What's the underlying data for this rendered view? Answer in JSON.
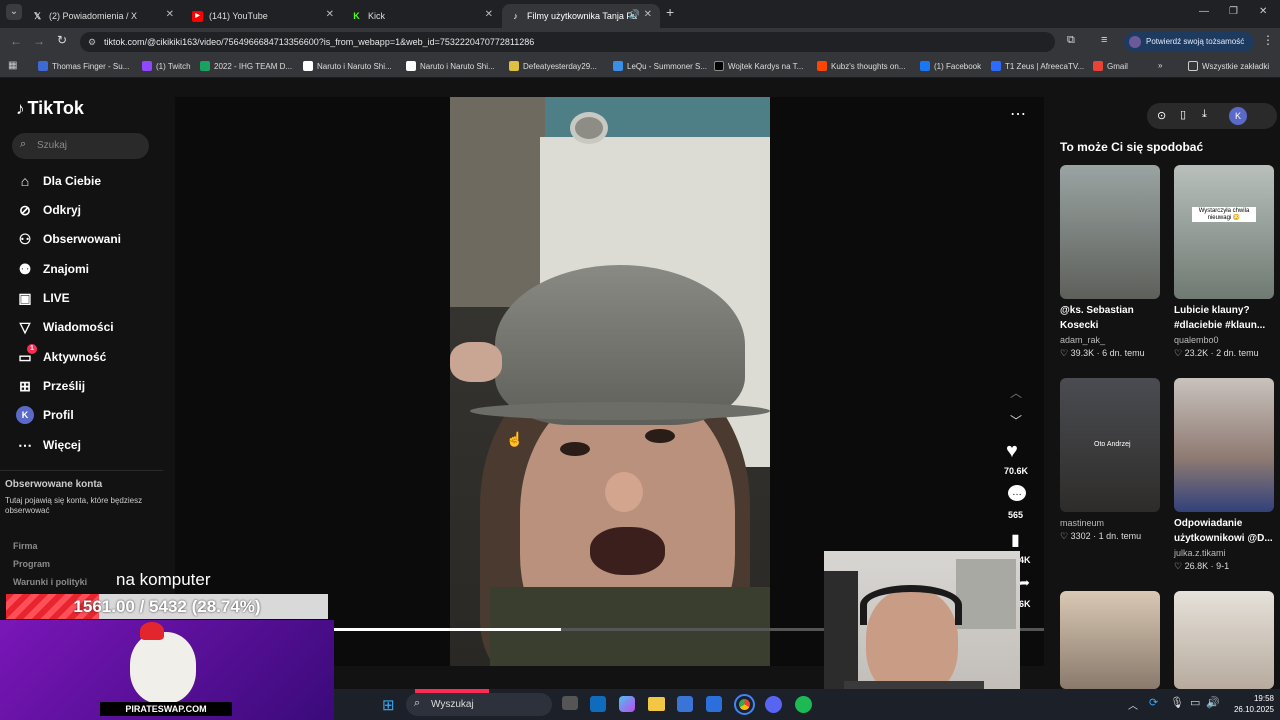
{
  "browser": {
    "tabs": [
      {
        "title": "(2) Powiadomienia / X",
        "icon": "x-logo-icon"
      },
      {
        "title": "(141) YouTube",
        "icon": "youtube-icon"
      },
      {
        "title": "Kick",
        "icon": "kick-icon"
      },
      {
        "title": "Filmy użytkownika Tanja Fa",
        "icon": "tiktok-icon"
      }
    ],
    "url": "tiktok.com/@cikikiki163/video/7564966684713356600?is_from_webapp=1&web_id=7532220470772811286",
    "identity_button": "Potwierdź swoją tożsamość",
    "bookmarks": [
      "Thomas Finger - Su...",
      "(1) Twitch",
      "2022 - IHG TEAM D...",
      "Naruto i Naruto Shi...",
      "Naruto i Naruto Shi...",
      "Defeatyesterday29...",
      "LeQu - Summoner S...",
      "Wojtek Kardys na T...",
      "Kubz's thoughts on...",
      "(1) Facebook",
      "T1 Zeus | AfreecaTV...",
      "Gmail"
    ],
    "all_bookmarks": "Wszystkie zakładki"
  },
  "tiktok": {
    "logo": "TikTok",
    "search_placeholder": "Szukaj",
    "nav": [
      {
        "label": "Dla Ciebie",
        "icon": "home-icon"
      },
      {
        "label": "Odkryj",
        "icon": "compass-icon"
      },
      {
        "label": "Obserwowani",
        "icon": "following-icon"
      },
      {
        "label": "Znajomi",
        "icon": "friends-icon"
      },
      {
        "label": "LIVE",
        "icon": "live-icon"
      },
      {
        "label": "Wiadomości",
        "icon": "messages-icon"
      },
      {
        "label": "Aktywność",
        "icon": "activity-icon",
        "badge": "1"
      },
      {
        "label": "Prześlij",
        "icon": "upload-icon"
      },
      {
        "label": "Profil",
        "icon": "profile-avatar",
        "avatar": "K"
      },
      {
        "label": "Więcej",
        "icon": "more-icon"
      }
    ],
    "followed_heading": "Obserwowane konta",
    "followed_text": "Tutaj pojawią się konta, które będziesz obserwować",
    "footer_links": [
      "Firma",
      "Program",
      "Warunki i polityki"
    ],
    "likes": "70.6K",
    "comments": "565",
    "saves": "4K",
    "shares": "6K",
    "rail_heading": "To może Ci się spodobać",
    "cards": [
      {
        "title": "@ks. Sebastian Kosecki",
        "user": "adam_rak_",
        "likes": "39.3K",
        "date": "6 dn. temu",
        "color": "#6b6f6a"
      },
      {
        "title": "Lubicie klauny? #dlaciebie #klaun...",
        "user": "qualembo0",
        "likes": "23.2K",
        "date": "2 dn. temu",
        "color": "#7d8680",
        "overlay": "Wystarczyła chwila nieuwagi 😳"
      },
      {
        "title": "",
        "user": "mastineum",
        "likes": "3302",
        "date": "1 dn. temu",
        "color": "#3a3b3f",
        "overlay": "Oto Andrzej"
      },
      {
        "title": "Odpowiadanie użytkownikowi @D...",
        "user": "julka.z.tikami",
        "likes": "26.8K",
        "date": "9-1",
        "color": "#a28f86"
      },
      {
        "title": "",
        "user": "",
        "likes": "",
        "date": "",
        "color": "#8d8175"
      },
      {
        "title": "",
        "user": "",
        "likes": "",
        "date": "",
        "color": "#cfc7bf"
      }
    ],
    "top_avatar": "K"
  },
  "overlay": {
    "caption": "na komputer",
    "progress_text": "1561.00 / 5432 (28.74%)",
    "progress_fraction": 0.2874,
    "brand": "PIRATESWAP.COM"
  },
  "taskbar": {
    "search_placeholder": "Wyszukaj",
    "time": "19:58",
    "date": "26.10.2025"
  }
}
